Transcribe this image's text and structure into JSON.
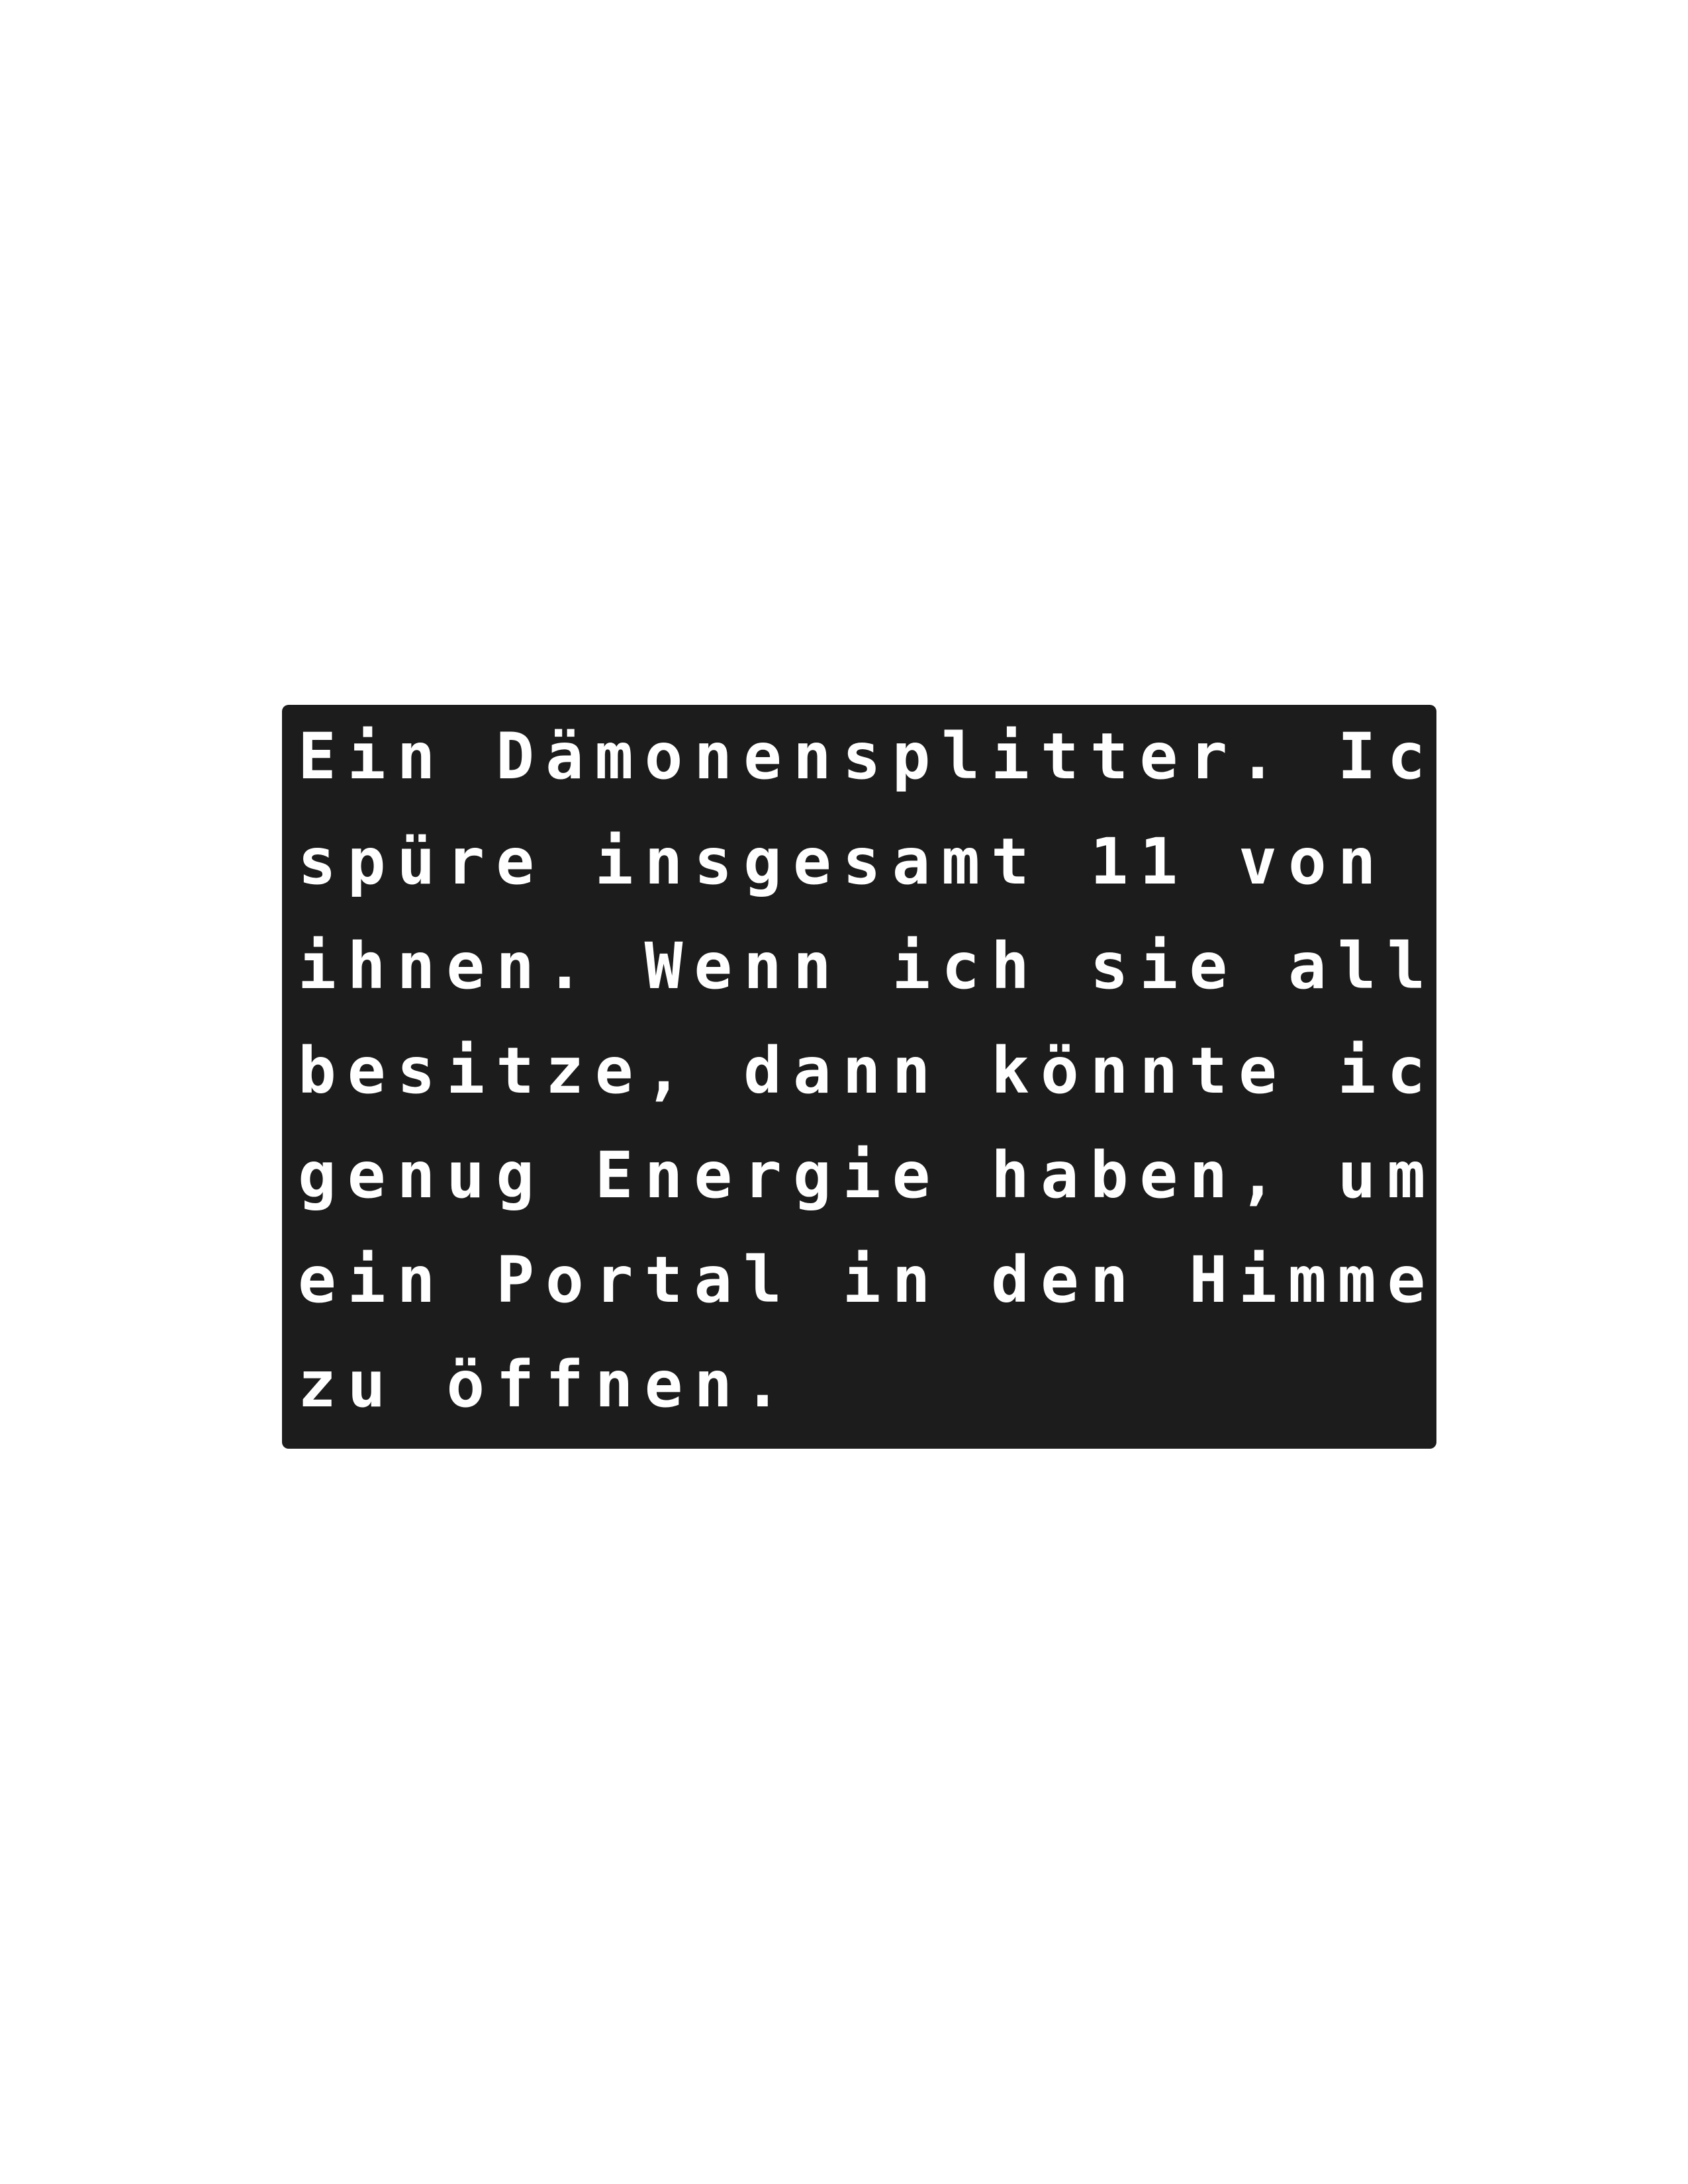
{
  "dialog": {
    "lines": [
      "Ein Dämonensplitter. Ich",
      "spüre insgesamt 11 von",
      "ihnen. Wenn ich sie alle",
      "besitze, dann könnte ich",
      "genug Energie haben, um",
      "ein Portal in den Himmel",
      "zu öffnen."
    ],
    "background_color": "#1c1c1c",
    "text_color": "#ffffff"
  }
}
